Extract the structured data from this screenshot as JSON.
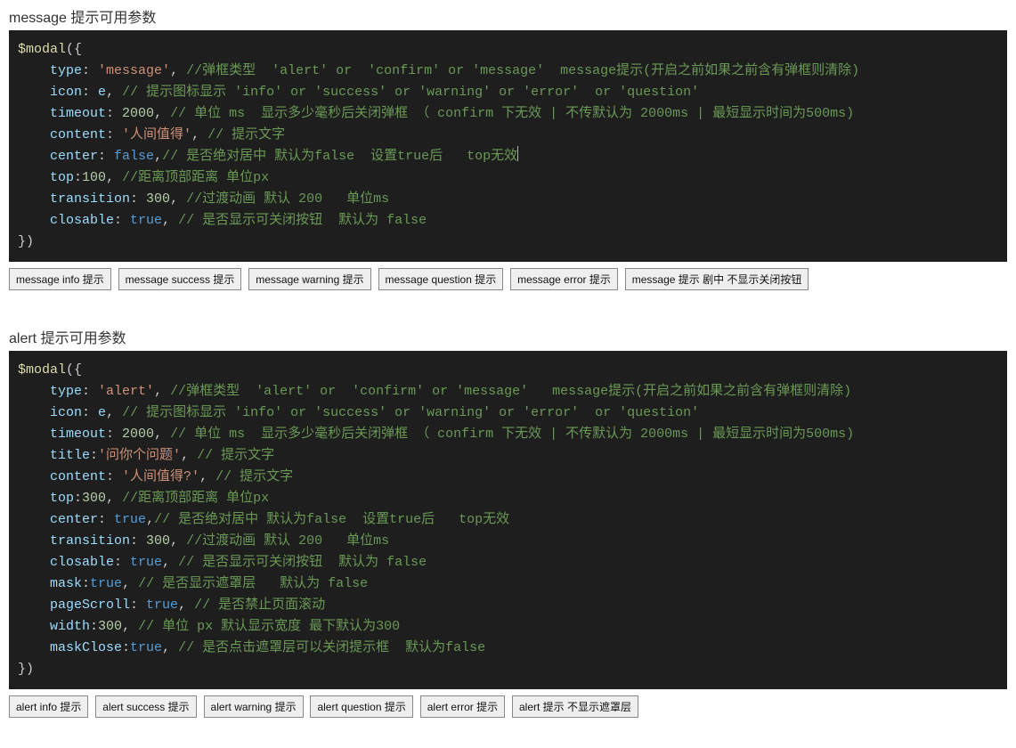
{
  "sections": {
    "message": {
      "title": "message 提示可用参数",
      "code": {
        "fn": "$modal",
        "type": "'message'",
        "type_comment": "//弹框类型  'alert' or  'confirm' or 'message'  message提示(开启之前如果之前含有弹框则清除)",
        "icon": "e",
        "icon_comment": "// 提示图标显示 'info' or 'success' or 'warning' or 'error'  or 'question'",
        "timeout": "2000",
        "timeout_comment": "// 单位 ms  显示多少毫秒后关闭弹框 （ confirm 下无效 | 不传默认为 2000ms | 最短显示时间为500ms)",
        "content": "'人间值得'",
        "content_comment": "// 提示文字",
        "center": "false",
        "center_comment": "// 是否绝对居中 默认为false  设置true后   top无效",
        "top": "100",
        "top_comment": "//距离顶部距离 单位px",
        "transition": "300",
        "transition_comment": "//过渡动画 默认 200   单位ms",
        "closable": "true",
        "closable_comment": "// 是否显示可关闭按钮  默认为 false"
      },
      "buttons": [
        "message info 提示",
        "message success 提示",
        "message warning 提示",
        "message question 提示",
        "message error 提示",
        "message 提示 剧中 不显示关闭按钮"
      ]
    },
    "alert": {
      "title": "alert 提示可用参数",
      "code": {
        "fn": "$modal",
        "type": "'alert'",
        "type_comment": "//弹框类型  'alert' or  'confirm' or 'message'   message提示(开启之前如果之前含有弹框则清除)",
        "icon": "e",
        "icon_comment": "// 提示图标显示 'info' or 'success' or 'warning' or 'error'  or 'question'",
        "timeout": "2000",
        "timeout_comment": "// 单位 ms  显示多少毫秒后关闭弹框 （ confirm 下无效 | 不传默认为 2000ms | 最短显示时间为500ms)",
        "title": "'问你个问题'",
        "title_comment": "// 提示文字",
        "content": "'人间值得?'",
        "content_comment": "// 提示文字",
        "top": "300",
        "top_comment": "//距离顶部距离 单位px",
        "center": "true",
        "center_comment": "// 是否绝对居中 默认为false  设置true后   top无效",
        "transition": "300",
        "transition_comment": "//过渡动画 默认 200   单位ms",
        "closable": "true",
        "closable_comment": "// 是否显示可关闭按钮  默认为 false",
        "mask": "true",
        "mask_comment": "// 是否显示遮罩层   默认为 false",
        "pageScroll": "true",
        "pageScroll_comment": "// 是否禁止页面滚动",
        "width": "300",
        "width_comment": "// 单位 px 默认显示宽度 最下默认为300",
        "maskClose": "true",
        "maskClose_comment": "// 是否点击遮罩层可以关闭提示框  默认为false"
      },
      "buttons": [
        "alert info 提示",
        "alert success 提示",
        "alert warning 提示",
        "alert question 提示",
        "alert error 提示",
        "alert 提示 不显示遮罩层"
      ]
    }
  }
}
